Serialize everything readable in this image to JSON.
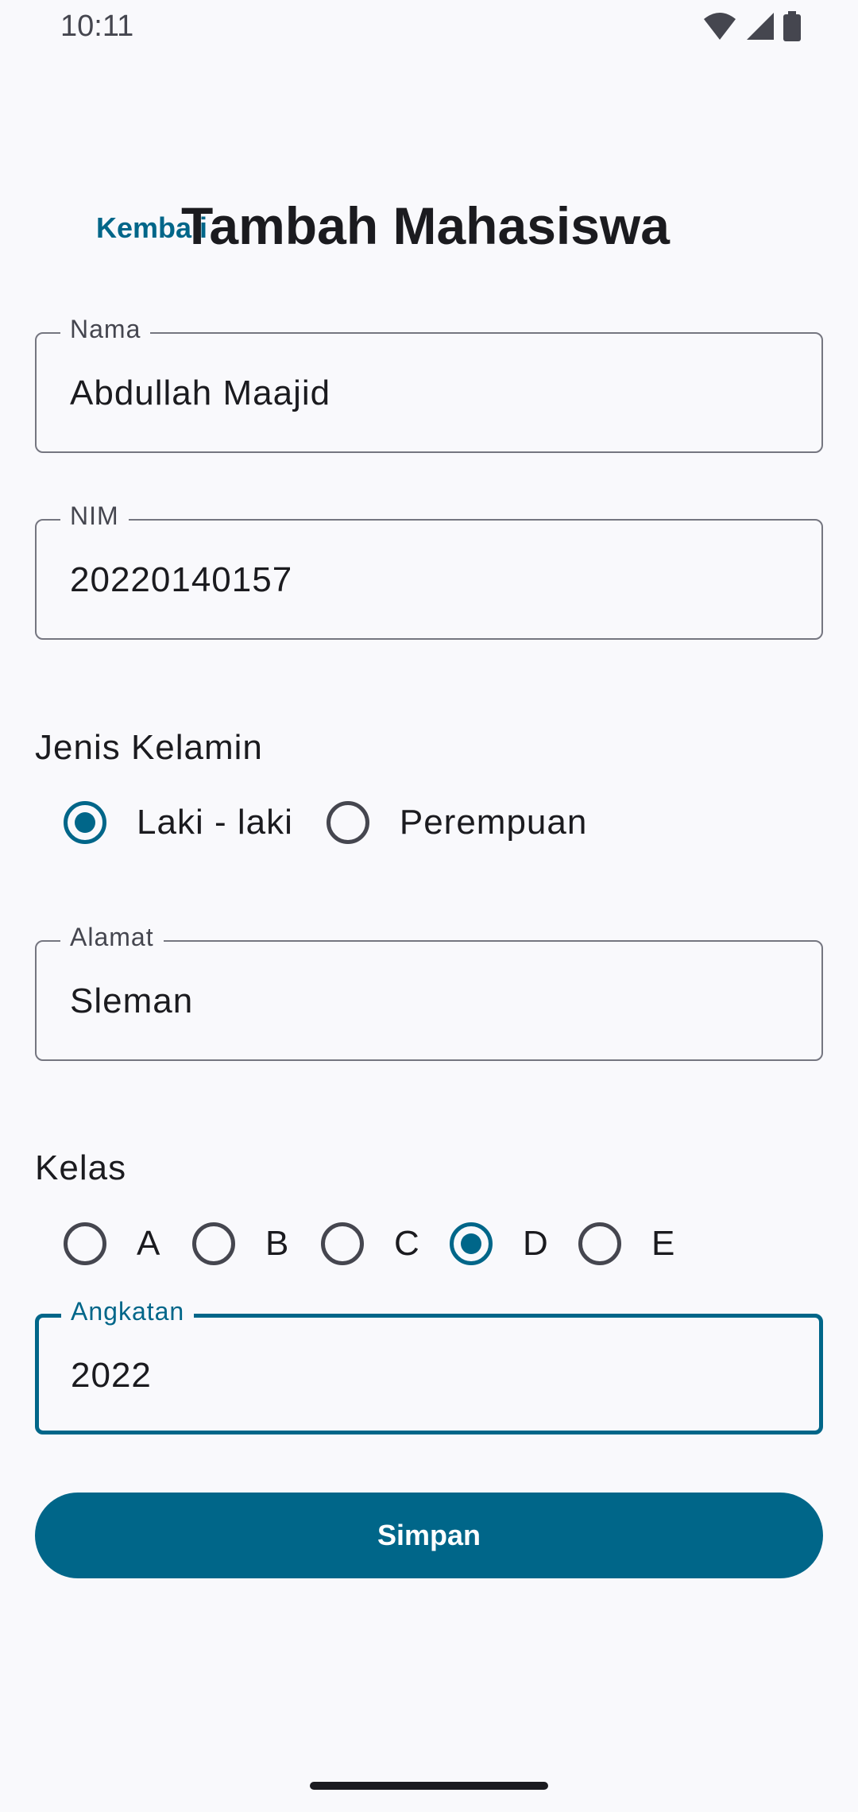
{
  "status_bar": {
    "time": "10:11",
    "icons": [
      "wifi-icon",
      "signal-icon",
      "battery-icon"
    ]
  },
  "header": {
    "back_label": "Kembali",
    "title": "Tambah Mahasiswa"
  },
  "form": {
    "nama": {
      "label": "Nama",
      "value": "Abdullah Maajid"
    },
    "nim": {
      "label": "NIM",
      "value": "20220140157"
    },
    "gender": {
      "label": "Jenis Kelamin",
      "options": [
        "Laki - laki",
        "Perempuan"
      ],
      "selected": "Laki - laki"
    },
    "alamat": {
      "label": "Alamat",
      "value": "Sleman"
    },
    "kelas": {
      "label": "Kelas",
      "options": [
        "A",
        "B",
        "C",
        "D",
        "E"
      ],
      "selected": "D"
    },
    "angkatan": {
      "label": "Angkatan",
      "value": "2022"
    }
  },
  "actions": {
    "save_label": "Simpan"
  },
  "colors": {
    "accent": "#006689",
    "background": "#f9f9fc",
    "outline": "#757680",
    "text": "#1b1b1f"
  }
}
